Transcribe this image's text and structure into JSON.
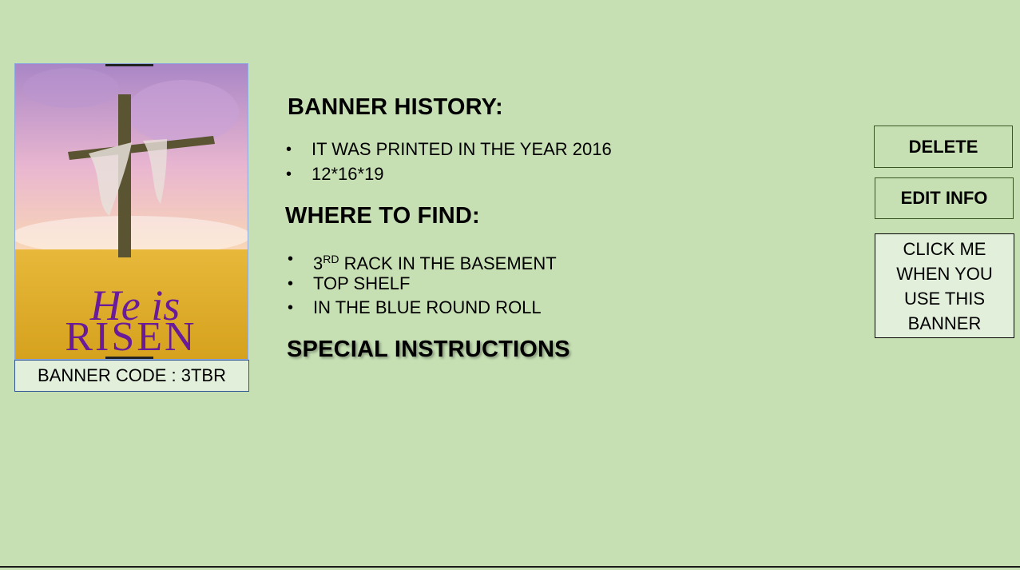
{
  "banner": {
    "image_icon": "he-is-risen-cross-banner",
    "image_text_script": "He is",
    "image_text_main": "RISEN",
    "code_label": "BANNER CODE : 3TBR"
  },
  "history": {
    "title": "BANNER HISTORY:",
    "items": [
      "IT WAS PRINTED IN THE YEAR 2016",
      "12*16*19"
    ]
  },
  "where_to_find": {
    "title": "WHERE TO FIND:",
    "item1_prefix": "3",
    "item1_sup": "RD",
    "item1_rest": " RACK IN THE BASEMENT",
    "items": [
      "TOP SHELF",
      "IN THE BLUE ROUND ROLL"
    ]
  },
  "special_instructions": {
    "title": "SPECIAL INSTRUCTIONS"
  },
  "actions": {
    "delete_label": "DELETE",
    "edit_label": "EDIT INFO",
    "use_label_lines": [
      "CLICK ME",
      "WHEN YOU",
      "USE THIS",
      "BANNER"
    ]
  },
  "colors": {
    "background": "#c6e0b4",
    "panel": "#e2efda",
    "accent_purple": "#6a1b9a"
  }
}
